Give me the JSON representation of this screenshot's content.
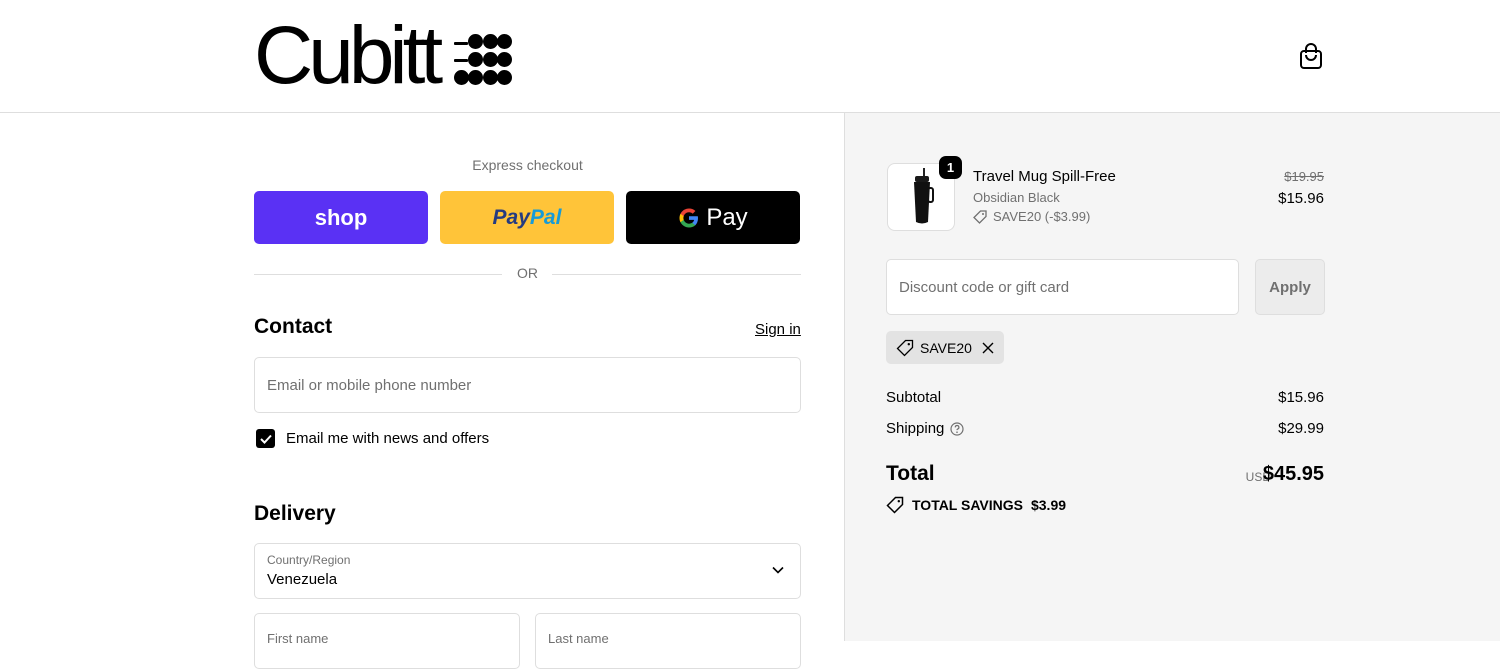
{
  "header": {
    "logo_text": "Cubitt",
    "cart_icon": "shopping-bag-icon"
  },
  "express": {
    "label": "Express checkout",
    "shop_label": "shop",
    "paypal_label_a": "Pay",
    "paypal_label_b": "Pal",
    "gpay_label": "Pay",
    "or_label": "OR"
  },
  "contact": {
    "title": "Contact",
    "signin_label": "Sign in",
    "email_placeholder": "Email or mobile phone number",
    "news_label": "Email me with news and offers",
    "news_checked": true
  },
  "delivery": {
    "title": "Delivery",
    "country_label": "Country/Region",
    "country_value": "Venezuela",
    "first_name_label": "First name",
    "last_name_label": "Last name"
  },
  "order": {
    "item": {
      "name": "Travel Mug Spill-Free",
      "variant": "Obsidian Black",
      "discount": "SAVE20 (-$3.99)",
      "quantity": "1",
      "price_old": "$19.95",
      "price_new": "$15.96"
    },
    "discount_placeholder": "Discount code or gift card",
    "apply_label": "Apply",
    "applied_code": "SAVE20",
    "subtotal_label": "Subtotal",
    "subtotal_value": "$15.96",
    "shipping_label": "Shipping",
    "shipping_value": "$29.99",
    "total_label": "Total",
    "total_currency": "USD",
    "total_value": "$45.95",
    "savings_label": "TOTAL SAVINGS",
    "savings_value": "$3.99"
  },
  "colors": {
    "shop_purple": "#5a31f4",
    "paypal_yellow": "#ffc439",
    "summary_bg": "#f5f5f5"
  }
}
